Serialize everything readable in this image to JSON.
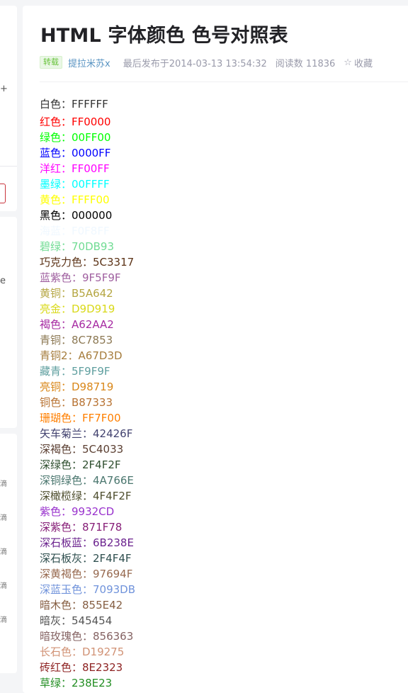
{
  "left_sidebar": {
    "glyph_plus": "+",
    "glyph_e": "e",
    "glyph_rows": [
      "滴",
      "滴",
      "滴",
      "滴",
      "滴"
    ]
  },
  "article": {
    "title": "HTML 字体颜色 色号对照表",
    "meta": {
      "badge": "转载",
      "author": "提拉米苏x",
      "published": "最后发布于2014-03-13 13:54:32",
      "reads": "阅读数 11836",
      "favorite_icon": "star-outline-icon",
      "favorite": "收藏"
    },
    "colors": [
      {
        "text": "白色：FFFFFF",
        "color": "#333333"
      },
      {
        "text": "红色：FF0000",
        "color": "#FF0000"
      },
      {
        "text": "绿色：00FF00",
        "color": "#00FF00"
      },
      {
        "text": "蓝色：0000FF",
        "color": "#0000FF"
      },
      {
        "text": "洋红：FF00FF",
        "color": "#FF00FF"
      },
      {
        "text": "墨绿：00FFFF",
        "color": "#00FFFF"
      },
      {
        "text": "黄色：FFFF00",
        "color": "#FFFF00"
      },
      {
        "text": "黑色：000000",
        "color": "#000000"
      },
      {
        "text": "海蓝：F0F8FF",
        "color": "#F0F8FF"
      },
      {
        "text": "碧绿：70DB93",
        "color": "#70DB93"
      },
      {
        "text": "巧克力色：5C3317",
        "color": "#5C3317"
      },
      {
        "text": "蓝紫色：9F5F9F",
        "color": "#9F5F9F"
      },
      {
        "text": "黄铜：B5A642",
        "color": "#B5A642"
      },
      {
        "text": "亮金：D9D919",
        "color": "#D9D919"
      },
      {
        "text": "褐色：A62AA2",
        "color": "#A62AA2"
      },
      {
        "text": "青铜：8C7853",
        "color": "#8C7853"
      },
      {
        "text": "青铜2：A67D3D",
        "color": "#A67D3D"
      },
      {
        "text": "藏青：5F9F9F",
        "color": "#5F9F9F"
      },
      {
        "text": "亮铜：D98719",
        "color": "#D98719"
      },
      {
        "text": "铜色：B87333",
        "color": "#B87333"
      },
      {
        "text": "珊瑚色：FF7F00",
        "color": "#FF7F00"
      },
      {
        "text": "矢车菊兰：42426F",
        "color": "#42426F"
      },
      {
        "text": "深褐色：5C4033",
        "color": "#5C4033"
      },
      {
        "text": "深绿色：2F4F2F",
        "color": "#2F4F2F"
      },
      {
        "text": "深铜绿色：4A766E",
        "color": "#4A766E"
      },
      {
        "text": "深橄榄绿：4F4F2F",
        "color": "#4F4F2F"
      },
      {
        "text": "紫色：9932CD",
        "color": "#9932CD"
      },
      {
        "text": "深紫色：871F78",
        "color": "#871F78"
      },
      {
        "text": "深石板蓝：6B238E",
        "color": "#6B238E"
      },
      {
        "text": "深石板灰：2F4F4F",
        "color": "#2F4F4F"
      },
      {
        "text": "深黄褐色：97694F",
        "color": "#97694F"
      },
      {
        "text": "深蓝玉色：7093DB",
        "color": "#7093DB"
      },
      {
        "text": "暗木色：855E42",
        "color": "#855E42"
      },
      {
        "text": "暗灰：545454",
        "color": "#545454"
      },
      {
        "text": "暗玫瑰色：856363",
        "color": "#856363"
      },
      {
        "text": "长石色：D19275",
        "color": "#D19275"
      },
      {
        "text": "砖红色：8E2323",
        "color": "#8E2323"
      },
      {
        "text": "草绿：238E23",
        "color": "#238E23"
      }
    ]
  }
}
